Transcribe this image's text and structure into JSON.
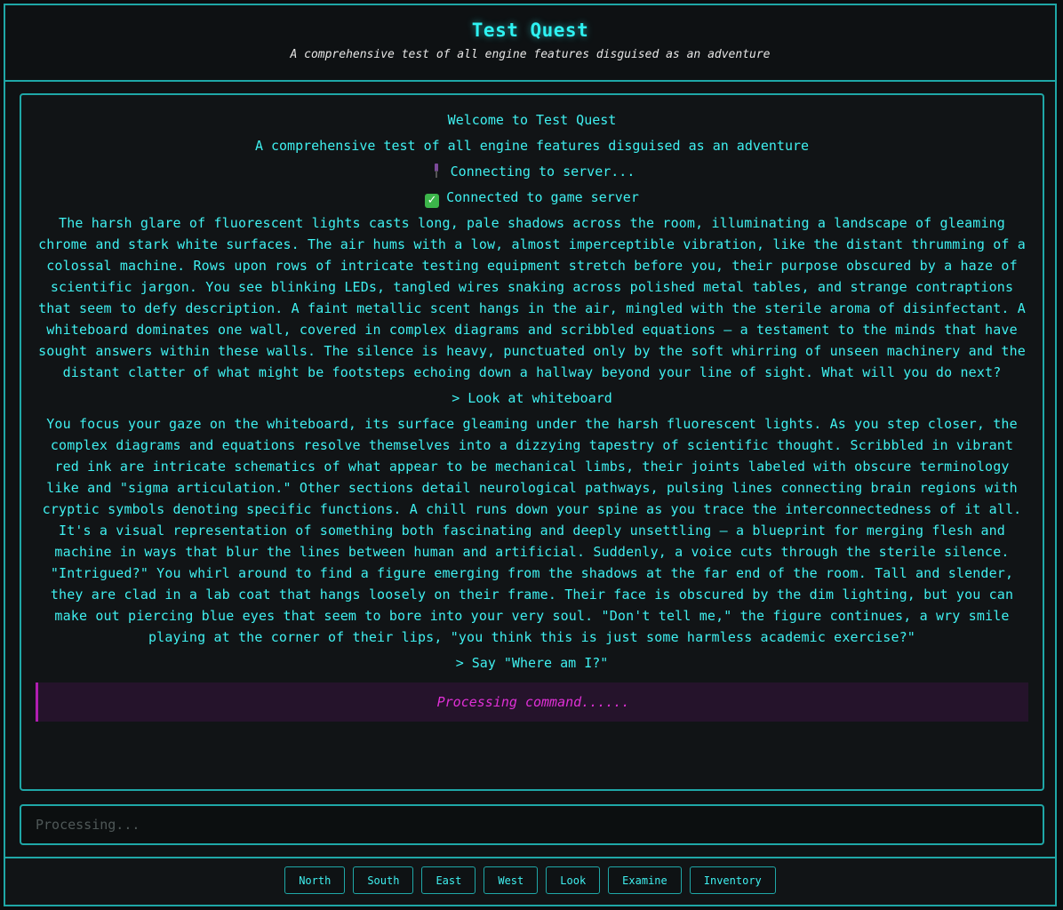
{
  "header": {
    "title": "Test Quest",
    "subtitle": "A comprehensive test of all engine features disguised as an adventure"
  },
  "story": {
    "welcome": "Welcome to Test Quest",
    "tagline": "A comprehensive test of all engine features disguised as an adventure",
    "connecting_text": "Connecting to server...",
    "connecting_icon": "plug-icon",
    "connected_text": "Connected to game server",
    "connected_icon": "check-icon",
    "intro": "The harsh glare of fluorescent lights casts long, pale shadows across the room, illuminating a landscape of gleaming chrome and stark white surfaces. The air hums with a low, almost imperceptible vibration, like the distant thrumming of a colossal machine. Rows upon rows of intricate testing equipment stretch before you, their purpose obscured by a haze of scientific jargon. You see blinking LEDs, tangled wires snaking across polished metal tables, and strange contraptions that seem to defy description. A faint metallic scent hangs in the air, mingled with the sterile aroma of disinfectant. A whiteboard dominates one wall, covered in complex diagrams and scribbled equations – a testament to the minds that have sought answers within these walls. The silence is heavy, punctuated only by the soft whirring of unseen machinery and the distant clatter of what might be footsteps echoing down a hallway beyond your line of sight. What will you do next?",
    "command_1": "> Look at whiteboard",
    "response_1": "You focus your gaze on the whiteboard, its surface gleaming under the harsh fluorescent lights. As you step closer, the complex diagrams and equations resolve themselves into a dizzying tapestry of scientific thought. Scribbled in vibrant red ink are intricate schematics of what appear to be mechanical limbs, their joints labeled with obscure terminology like and \"sigma articulation.\" Other sections detail neurological pathways, pulsing lines connecting brain regions with cryptic symbols denoting specific functions. A chill runs down your spine as you trace the interconnectedness of it all. It's a visual representation of something both fascinating and deeply unsettling – a blueprint for merging flesh and machine in ways that blur the lines between human and artificial. Suddenly, a voice cuts through the sterile silence. \"Intrigued?\" You whirl around to find a figure emerging from the shadows at the far end of the room. Tall and slender, they are clad in a lab coat that hangs loosely on their frame. Their face is obscured by the dim lighting, but you can make out piercing blue eyes that seem to bore into your very soul. \"Don't tell me,\" the figure continues, a wry smile playing at the corner of their lips, \"you think this is just some harmless academic exercise?\"",
    "command_2": "> Say \"Where am I?\"",
    "processing": "Processing command......"
  },
  "input": {
    "placeholder": "Processing..."
  },
  "actions": {
    "buttons": [
      "North",
      "South",
      "East",
      "West",
      "Look",
      "Examine",
      "Inventory"
    ]
  },
  "colors": {
    "accent": "#1fa7a7",
    "text": "#3ff0f0",
    "processing": "#e030d6"
  }
}
